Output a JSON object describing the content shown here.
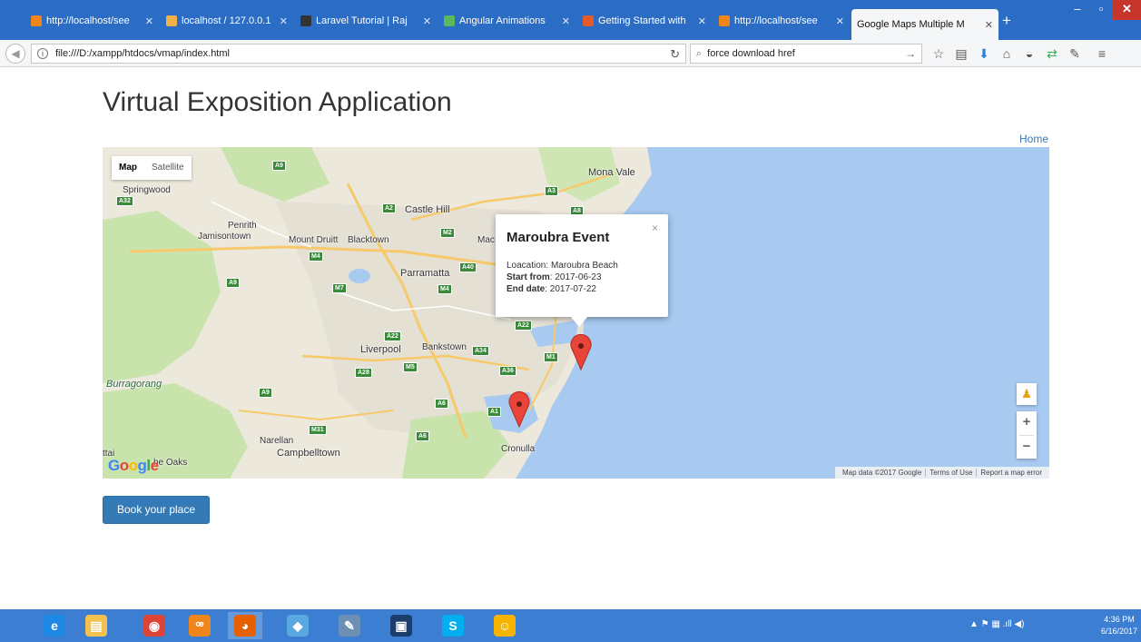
{
  "browser": {
    "tabs": [
      {
        "title": "http://localhost/see",
        "favicon_color": "#f0851a",
        "active": false
      },
      {
        "title": "localhost / 127.0.0.1",
        "favicon_color": "#f0b14a",
        "active": false
      },
      {
        "title": "Laravel Tutorial | Raj",
        "favicon_color": "#333333",
        "active": false
      },
      {
        "title": "Angular Animations",
        "favicon_color": "#5cb85c",
        "active": false
      },
      {
        "title": "Getting Started with",
        "favicon_color": "#e35a2c",
        "active": false
      },
      {
        "title": "http://localhost/see",
        "favicon_color": "#f0851a",
        "active": false
      },
      {
        "title": "Google Maps Multiple M",
        "favicon_color": "",
        "active": true
      }
    ],
    "new_tab": "+",
    "url": "file:///D:/xampp/htdocs/vmap/index.html",
    "search_value": "force download href",
    "window_controls": {
      "minimize": "–",
      "maximize": "▫",
      "close": "✕"
    }
  },
  "page": {
    "title": "Virtual Exposition Application",
    "nav_home": "Home",
    "book_button": "Book your place"
  },
  "map": {
    "type_map": "Map",
    "type_satellite": "Satellite",
    "places": {
      "mona_vale": "Mona Vale",
      "springwood": "Springwood",
      "castle_hill": "Castle Hill",
      "penrith": "Penrith",
      "jamisontown": "Jamisontown",
      "mount_druitt": "Mount Druitt",
      "blacktown": "Blacktown",
      "mac": "Mac",
      "parramatta": "Parramatta",
      "liverpool": "Liverpool",
      "bankstown": "Bankstown",
      "burragorang": "Burragorang",
      "narellan": "Narellan",
      "campbelltown": "Campbelltown",
      "cronulla": "Cronulla",
      "oaks": "he Oaks",
      "ttai": "ttai"
    },
    "shields": [
      "A9",
      "A32",
      "A3",
      "A2",
      "A8",
      "M2",
      "M4",
      "A40",
      "A9",
      "M7",
      "M4",
      "A22",
      "A22",
      "M5",
      "A34",
      "A28",
      "A36",
      "M1",
      "A9",
      "A6",
      "A1",
      "M31",
      "A6"
    ],
    "popup": {
      "title": "Maroubra Event",
      "close": "×",
      "location_label": "Loacation:",
      "location_value": "Maroubra Beach",
      "start_label": "Start from",
      "start_value": "2017-06-23",
      "end_label": "End date",
      "end_value": "2017-07-22"
    },
    "zoom_in": "+",
    "zoom_out": "−",
    "logo": "Google",
    "attribution": [
      "Map data ©2017 Google",
      "Terms of Use",
      "Report a map error"
    ],
    "colors": {
      "water": "#a8c9f0",
      "land": "#ece8dc",
      "urban": "#e4e0d4",
      "park": "#c9e3ad",
      "marker": "#e8443a"
    }
  },
  "taskbar": {
    "apps": [
      {
        "name": "internet-explorer",
        "glyph": "e",
        "color": "#1e88e5"
      },
      {
        "name": "file-explorer",
        "glyph": "▤",
        "color": "#f2c14e"
      },
      {
        "name": "chrome",
        "glyph": "◉",
        "color": "#db4437"
      },
      {
        "name": "xampp",
        "glyph": "ꟹ",
        "color": "#f0851a"
      },
      {
        "name": "firefox",
        "glyph": "◕",
        "color": "#e66000"
      },
      {
        "name": "app-diamond",
        "glyph": "◆",
        "color": "#5aa8e0"
      },
      {
        "name": "notepad",
        "glyph": "✎",
        "color": "#6d8fb3"
      },
      {
        "name": "virtualbox",
        "glyph": "▣",
        "color": "#1a3d6e"
      },
      {
        "name": "skype",
        "glyph": "S",
        "color": "#00aff0"
      },
      {
        "name": "app-face",
        "glyph": "☺",
        "color": "#f5b400"
      }
    ],
    "tray": "▲  ⚑  ▦  .ıll  ◀)",
    "time": "4:36 PM",
    "date": "6/16/2017"
  }
}
